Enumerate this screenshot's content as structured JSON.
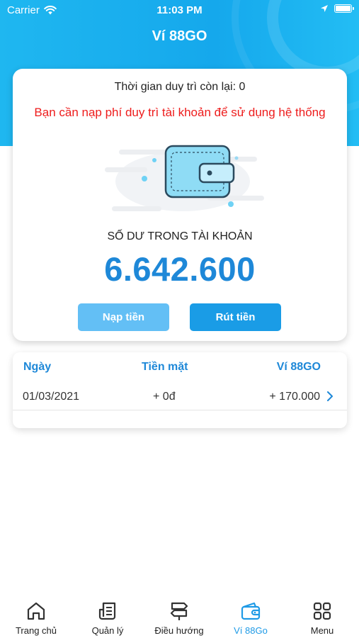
{
  "status_bar": {
    "carrier": "Carrier",
    "time": "11:03 PM"
  },
  "header": {
    "title": "Ví 88GO"
  },
  "account": {
    "remaining_time": "Thời gian duy trì còn lại: 0",
    "warning": "Bạn cần nạp phí duy trì tài khoản để sử dụng hệ thống",
    "balance_label": "SỐ DƯ TRONG TÀI KHOẢN",
    "balance_value": "6.642.600",
    "deposit_label": "Nạp tiền",
    "withdraw_label": "Rút tiền"
  },
  "history": {
    "columns": [
      "Ngày",
      "Tiền mặt",
      "Ví 88GO"
    ],
    "rows": [
      {
        "date": "01/03/2021",
        "cash": "+ 0đ",
        "wallet": "+ 170.000"
      }
    ]
  },
  "tabbar": {
    "items": [
      {
        "label": "Trang chủ",
        "icon": "home-icon"
      },
      {
        "label": "Quản lý",
        "icon": "document-icon"
      },
      {
        "label": "Điều hướng",
        "icon": "signpost-icon"
      },
      {
        "label": "Ví 88Go",
        "icon": "wallet-icon"
      },
      {
        "label": "Menu",
        "icon": "grid-icon"
      }
    ],
    "active_index": 3
  },
  "colors": {
    "header": "#15a8ec",
    "accent": "#1e88d8",
    "warning": "#ee1c1c",
    "deposit_button": "#63bff5",
    "withdraw_button": "#1a9ce6"
  }
}
